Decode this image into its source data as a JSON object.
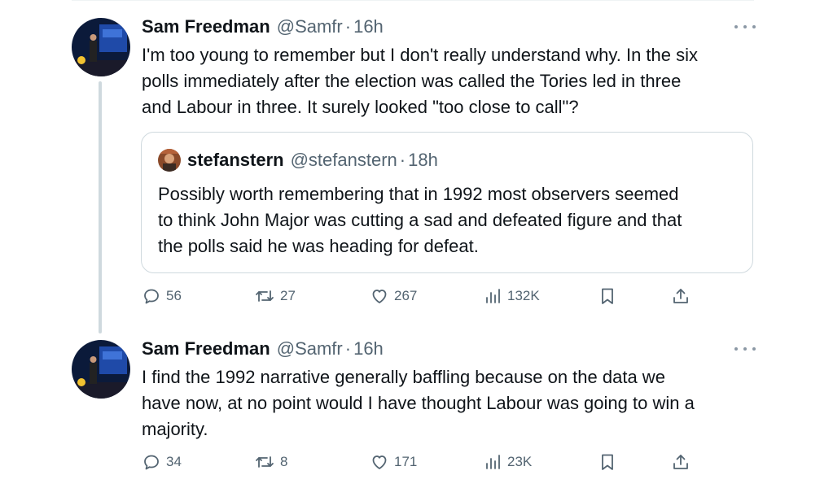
{
  "tweets": [
    {
      "author": "Sam Freedman",
      "handle": "@Samfr",
      "separator": "·",
      "time": "16h",
      "text_lines": [
        "I'm too young to remember but I don't really understand why. In the six",
        "polls immediately after the election was called the Tories led in three",
        "and Labour in three. It surely looked \"too close to call\"?"
      ],
      "quote": {
        "author": "stefanstern",
        "handle": "@stefanstern",
        "separator": "·",
        "time": "18h",
        "text_lines": [
          "Possibly worth remembering that in 1992 most observers seemed",
          "to think John Major was cutting a sad and defeated figure and that",
          "the polls said he was heading for defeat."
        ]
      },
      "stats": {
        "replies": "56",
        "reposts": "27",
        "likes": "267",
        "views": "132K"
      }
    },
    {
      "author": "Sam Freedman",
      "handle": "@Samfr",
      "separator": "·",
      "time": "16h",
      "text_lines": [
        "I find the 1992 narrative generally baffling because on the data we",
        "have now, at no point would I have thought Labour was going to win a",
        "majority."
      ],
      "stats": {
        "replies": "34",
        "reposts": "8",
        "likes": "171",
        "views": "23K"
      }
    }
  ],
  "colors": {
    "text": "#0f1419",
    "secondary": "#536471",
    "border": "#cfd9de",
    "thread": "#cfd9de"
  },
  "icons": [
    "reply-icon",
    "repost-icon",
    "like-icon",
    "views-icon",
    "bookmark-icon",
    "share-icon",
    "more-icon"
  ]
}
